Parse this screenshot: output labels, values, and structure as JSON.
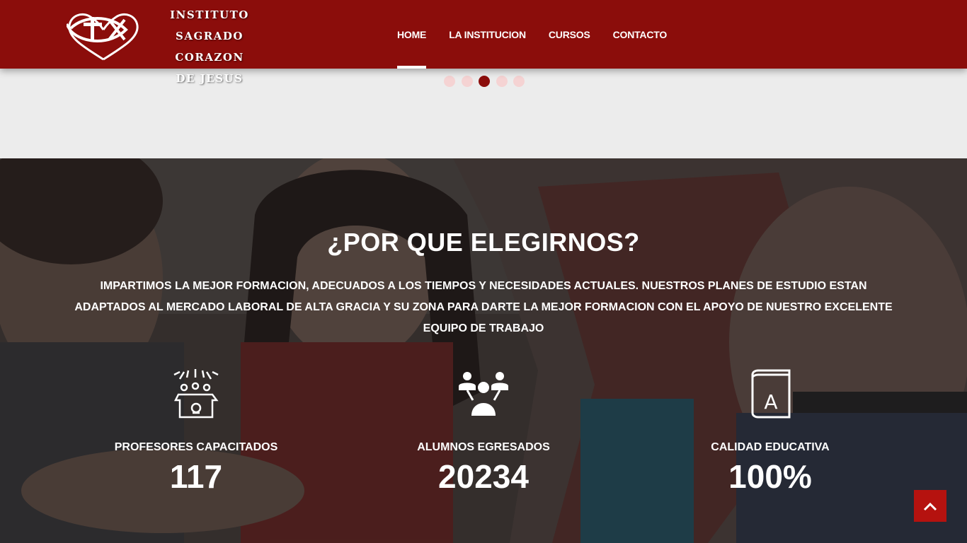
{
  "header": {
    "logo_lines": [
      "INSTITUTO",
      "SAGRADO CORAZON",
      "DE JESUS"
    ],
    "nav": [
      {
        "label": "HOME",
        "active": true
      },
      {
        "label": "LA INSTITUCION",
        "active": false
      },
      {
        "label": "CURSOS",
        "active": false
      },
      {
        "label": "CONTACTO",
        "active": false
      }
    ]
  },
  "carousel": {
    "slide_count": 5,
    "active_slide": 3
  },
  "why": {
    "title": "¿POR QUE ELEGIRNOS?",
    "description": "IMPARTIMOS LA MEJOR FORMACION, ADECUADOS A LOS TIEMPOS Y NECESIDADES ACTUALES. NUESTROS PLANES DE ESTUDIO ESTAN ADAPTADOS AL MERCADO LABORAL DE ALTA GRACIA Y SU ZONA PARA DARTE LA MEJOR FORMACION CON EL APOYO DE NUESTRO EXCELENTE EQUIPO DE TRABAJO",
    "stats": [
      {
        "icon": "teacher-box-icon",
        "label": "PROFESORES CAPACITADOS",
        "value": "117"
      },
      {
        "icon": "students-group-icon",
        "label": "ALUMNOS EGRESADOS",
        "value": "20234"
      },
      {
        "icon": "book-a-icon",
        "label": "CALIDAD EDUCATIVA",
        "value": "100%"
      }
    ]
  },
  "colors": {
    "brand": "#8b0d0b",
    "scroll_top": "#b5120f",
    "dot_inactive": "#f5d3d3"
  },
  "icons": {
    "scroll_top": "chevron-up-icon",
    "logo": "fish-heart-cross-icon"
  }
}
